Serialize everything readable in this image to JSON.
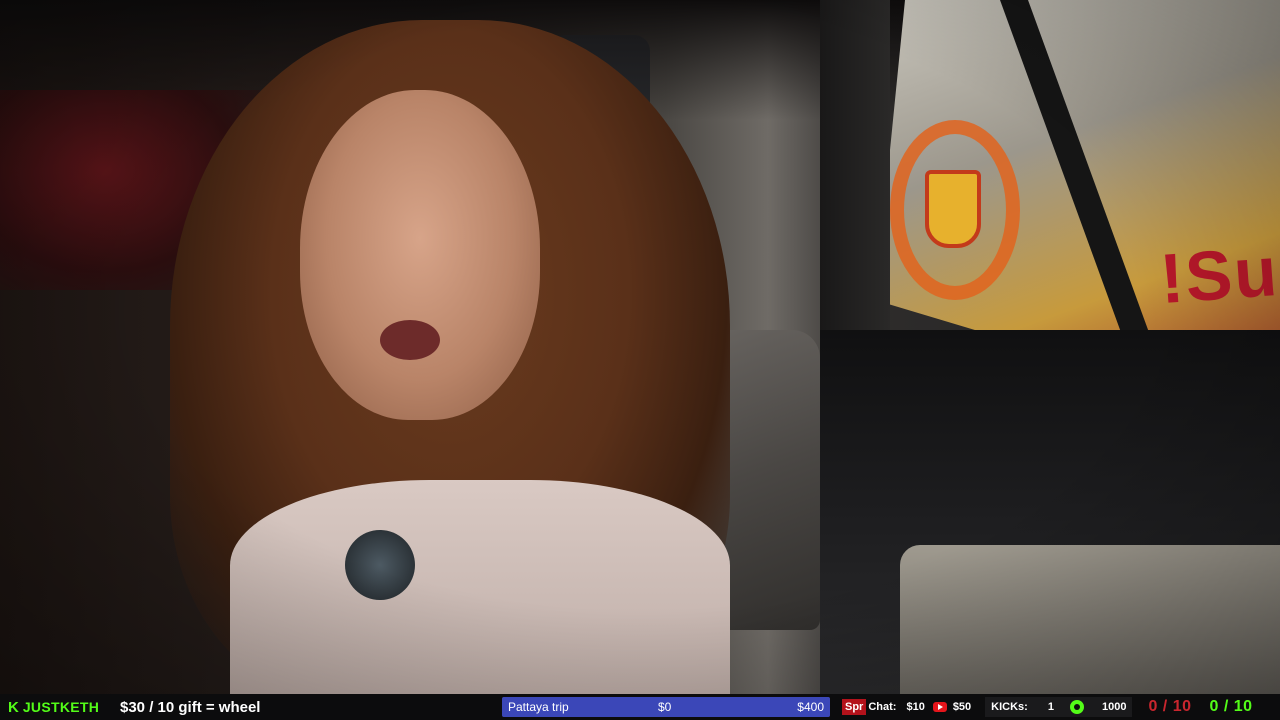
{
  "overlay": {
    "brand": {
      "name": "JUSTKETH"
    },
    "promo_text": "$30 / 10 gift = wheel",
    "goal": {
      "label": "Pattaya trip",
      "current": "$0",
      "target": "$400",
      "progress_fraction": 0.0
    },
    "super_chat": {
      "badge": "Spr",
      "label": "Chat:",
      "value": "$10",
      "youtube_value": "$50"
    },
    "kicks": {
      "label": "KICKs:",
      "count": "1",
      "target": "1000"
    },
    "counter_red": "0 / 10",
    "counter_green": "0 / 10"
  },
  "colors": {
    "kick_green": "#53fc18",
    "goal_fill": "#3b47b8",
    "super_chat_red": "#b3121b",
    "counter_red": "#c9262e",
    "bar_bg": "#0c0c0d"
  },
  "icons": [
    "kick-logo-icon",
    "youtube-icon",
    "kicks-coin-icon"
  ]
}
